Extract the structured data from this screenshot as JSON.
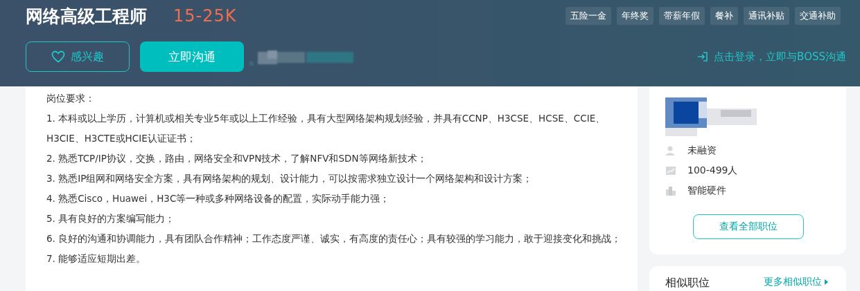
{
  "job": {
    "title": "网络高级工程师",
    "salary": "15-25K"
  },
  "benefits": [
    "五险一金",
    "年终奖",
    "带薪年假",
    "餐补",
    "通讯补贴",
    "交通补助"
  ],
  "actions": {
    "interest": "感兴趣",
    "chat": "立即沟通",
    "login": "点击登录，立即与BOSS沟通"
  },
  "description": {
    "heading": "岗位要求：",
    "lines": [
      "1. 本科或以上学历，计算机或相关专业5年或以上工作经验，具有大型网络架构规划经验，并具有CCNP、H3CSE、HCSE、CCIE、H3CIE、H3CTE或HCIE认证证书；",
      "2. 熟悉TCP/IP协议，交换，路由，网络安全和VPN技术，了解NFV和SDN等网络新技术；",
      "3. 熟悉IP组网和网络安全方案，具有网络架构的规划、设计能力，可以按需求独立设计一个网络架构和设计方案；",
      "4. 熟悉Cisco，Huawei，H3C等一种或多种网络设备的配置，实际动手能力强；",
      "5. 具有良好的方案编写能力；",
      "6. 良好的沟通和协调能力，具有团队合作精神；工作态度严谨、诚实，有高度的责任心；具有较强的学习能力，敢于迎接变化和挑战；",
      "7. 能够适应短期出差。"
    ]
  },
  "company": {
    "facts": [
      {
        "kind": "funding",
        "text": "未融资"
      },
      {
        "kind": "size",
        "text": "100-499人"
      },
      {
        "kind": "industry",
        "text": "智能硬件"
      }
    ],
    "all_jobs": "查看全部职位"
  },
  "similar": {
    "title": "相似职位",
    "more": "更多相似职位"
  }
}
